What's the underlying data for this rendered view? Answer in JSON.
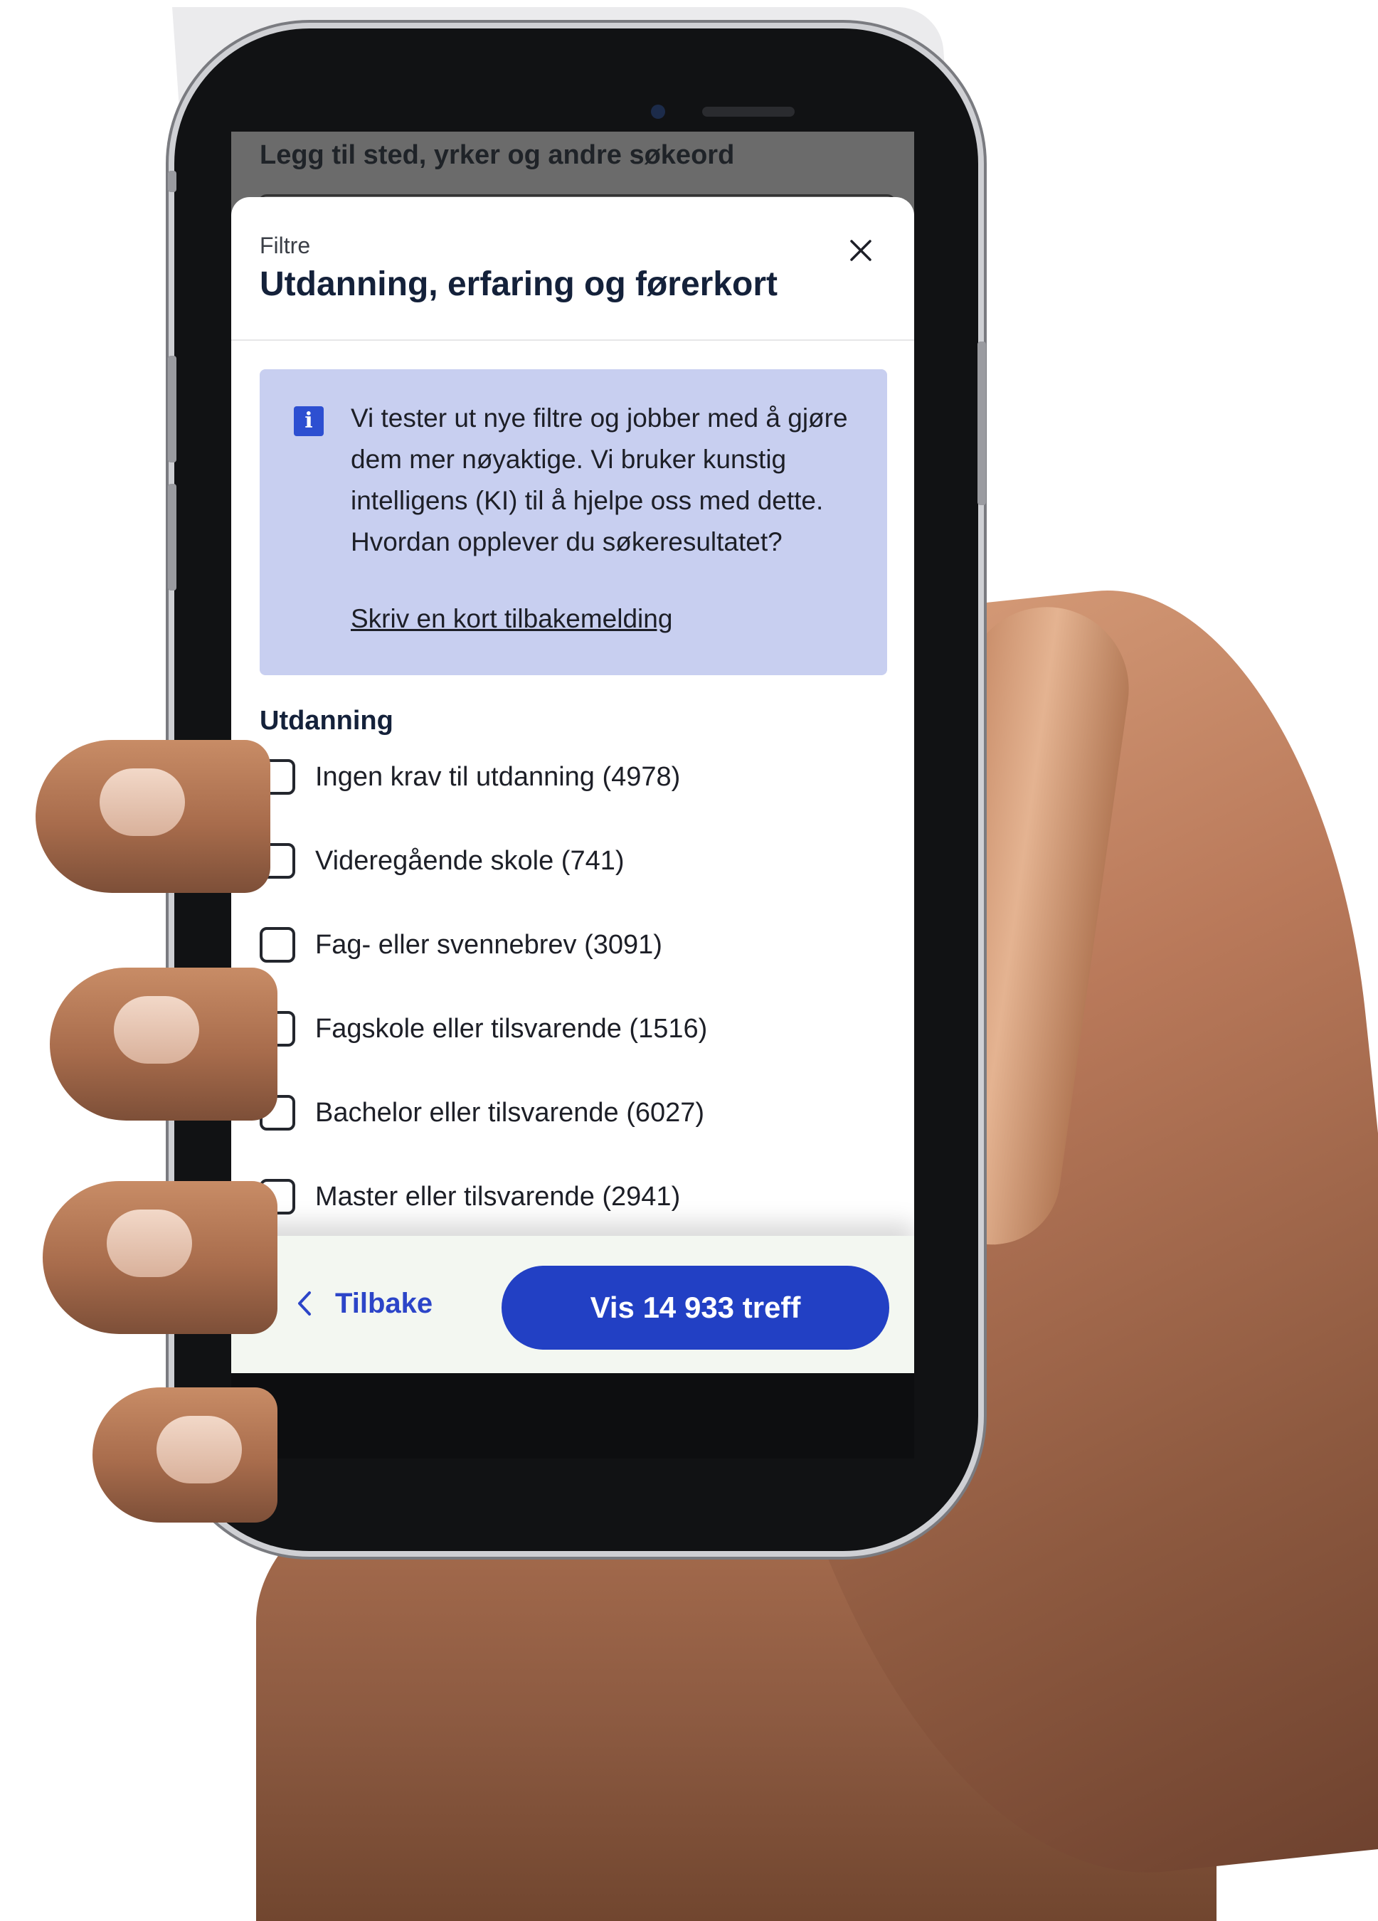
{
  "background_search": {
    "placeholder": "Legg til sted, yrker og andre søkeord"
  },
  "modal": {
    "eyebrow": "Filtre",
    "title": "Utdanning, erfaring og førerkort",
    "close_icon": "close-icon"
  },
  "info": {
    "icon": "info-icon",
    "text": "Vi tester ut nye filtre og jobber med å gjøre dem mer nøyaktige. Vi bruker kunstig intelligens (KI) til å hjelpe oss med dette. Hvordan opplever du søkeresultatet?",
    "link": "Skriv en kort tilbakemelding",
    "background_color": "#c8cff0"
  },
  "education": {
    "heading": "Utdanning",
    "options": [
      {
        "label": "Ingen krav til utdanning (4978)",
        "checked": false
      },
      {
        "label": "Videregående skole (741)",
        "checked": false
      },
      {
        "label": "Fag- eller svennebrev (3091)",
        "checked": false
      },
      {
        "label": "Fagskole eller tilsvarende (1516)",
        "checked": false
      },
      {
        "label": "Bachelor eller tilsvarende (6027)",
        "checked": false
      },
      {
        "label": "Master eller tilsvarende (2941)",
        "checked": false
      }
    ]
  },
  "footer": {
    "back_label": "Tilbake",
    "back_icon": "chevron-left-icon",
    "show_results_label": "Vis 14 933 treff",
    "accent_color": "#2240c4"
  }
}
